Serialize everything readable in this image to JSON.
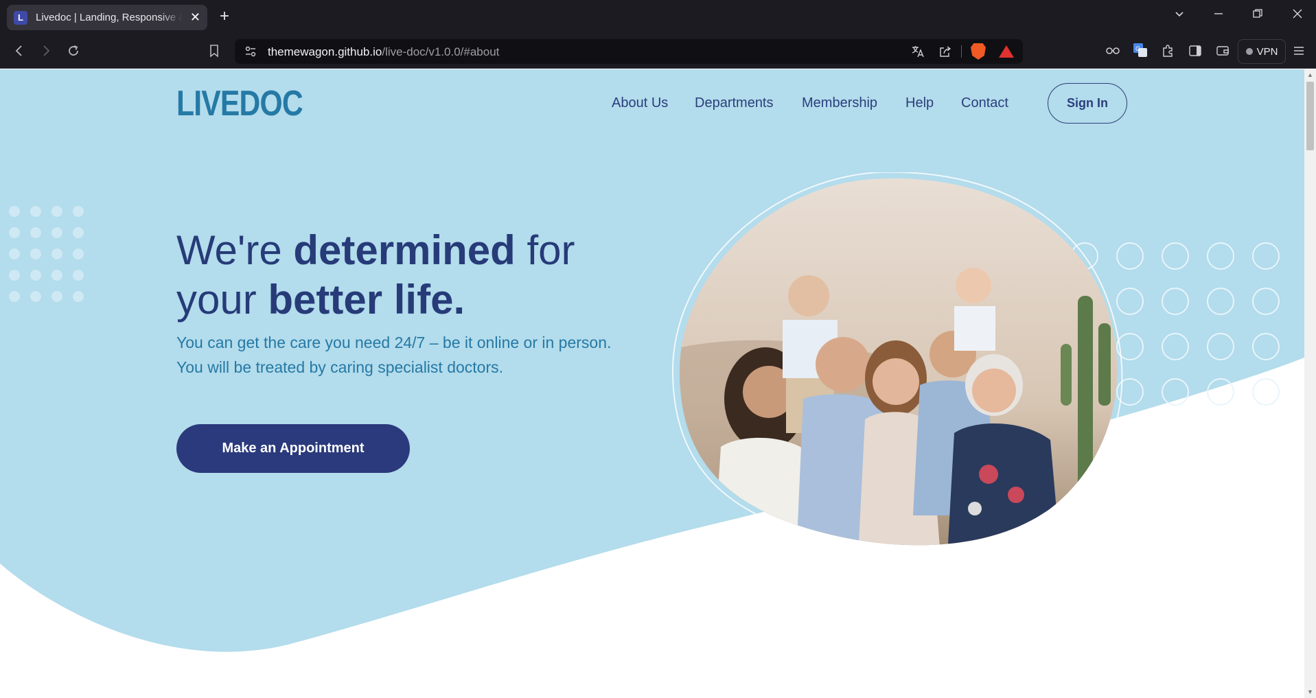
{
  "browser": {
    "tab_title": "Livedoc | Landing, Responsive &",
    "tab_favicon_letter": "L",
    "url_host": "themewagon.github.io",
    "url_path": "/live-doc/v1.0.0/#about",
    "vpn_label": "VPN",
    "colors": {
      "chrome": "#1c1b22",
      "url_bar": "#101014",
      "brave": "#f05a24"
    }
  },
  "site": {
    "logo": "LIVEDOC",
    "nav": [
      "About Us",
      "Departments",
      "Membership",
      "Help",
      "Contact"
    ],
    "sign_in": "Sign In",
    "hero": {
      "headline_1": "We're ",
      "headline_1_bold": "determined",
      "headline_2": " for",
      "headline_3": "your ",
      "headline_3_bold": "better life.",
      "subtext": "You can get the care you need 24/7 – be it online or in person. You will be treated by caring specialist doctors.",
      "cta": "Make an Appointment",
      "image": "family-photo"
    },
    "colors": {
      "hero_bg": "#b3dcec",
      "navy": "#263b78",
      "accent_blue": "#2579a5",
      "button": "#2b3a7c"
    }
  }
}
